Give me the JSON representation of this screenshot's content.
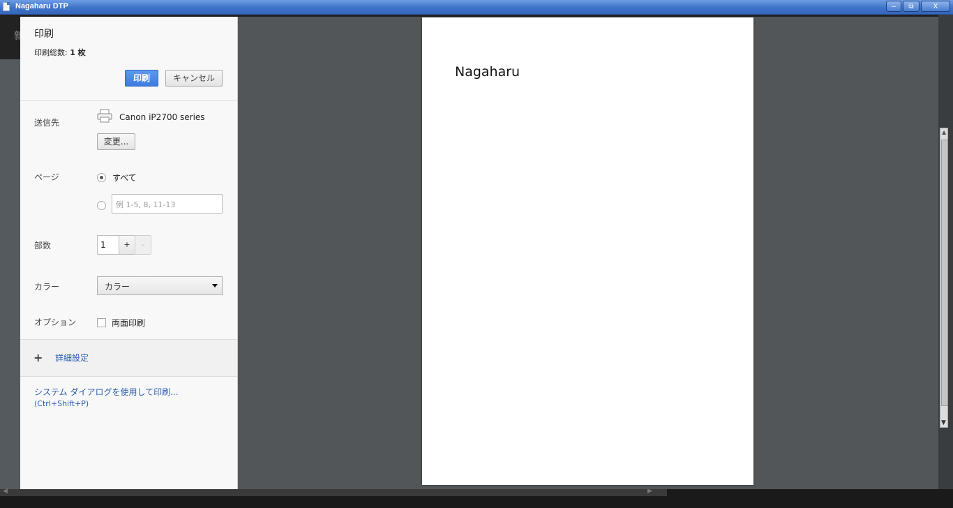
{
  "window": {
    "title": "Nagaharu DTP",
    "minimize": "–",
    "restore": "⧉",
    "close": "X"
  },
  "background_app": {
    "glyph": "新"
  },
  "print_panel": {
    "title": "印刷",
    "total_label": "印刷総数: ",
    "total_value": "1 枚",
    "print_button": "印刷",
    "cancel_button": "キャンセル",
    "destination": {
      "label": "送信先",
      "printer_icon": "printer-icon",
      "printer_name": "Canon iP2700 series",
      "change_button": "変更..."
    },
    "pages": {
      "label": "ページ",
      "all_label": "すべて",
      "all_selected": true,
      "custom_placeholder": "例 1-5, 8, 11-13"
    },
    "copies": {
      "label": "部数",
      "value": "1",
      "plus": "+",
      "minus": "–"
    },
    "color": {
      "label": "カラー",
      "selected": "カラー"
    },
    "options": {
      "label": "オプション",
      "duplex_label": "両面印刷",
      "duplex_checked": false
    },
    "advanced": {
      "icon": "plus-icon",
      "symbol": "+",
      "label": "詳細設定"
    },
    "system_dialog": {
      "label": "システム ダイアログを使用して印刷...",
      "shortcut": "(Ctrl+Shift+P)"
    }
  },
  "preview": {
    "page_text": "Nagaharu"
  },
  "colors": {
    "titlebar": "#3f73c9",
    "print_button": "#4285f4",
    "link": "#2a5db0",
    "preview_bg": "#525659"
  }
}
